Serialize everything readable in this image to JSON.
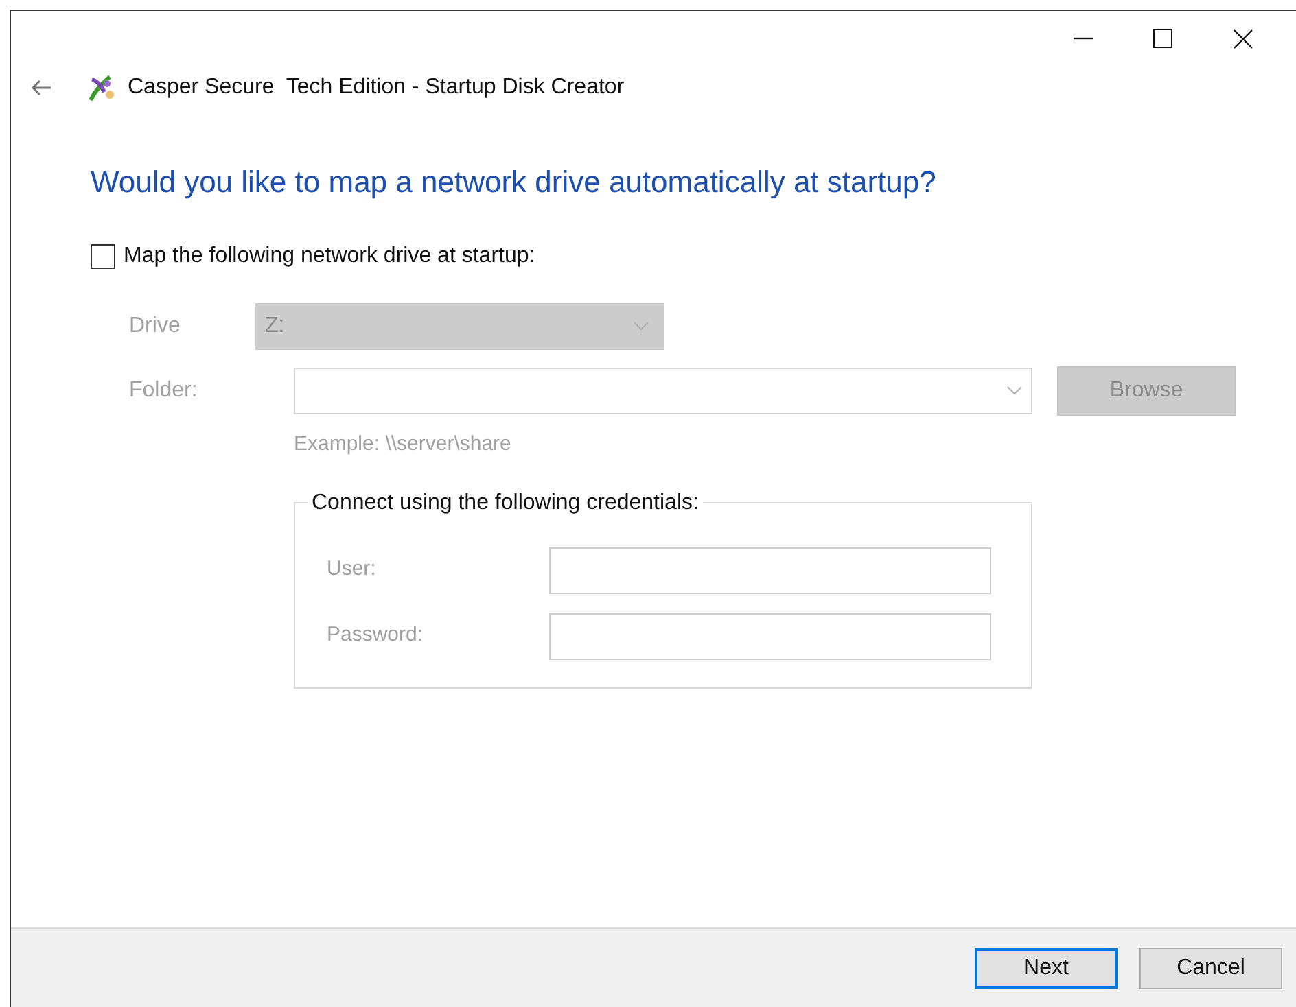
{
  "window": {
    "title": "Casper Secure  Tech Edition - Startup Disk Creator"
  },
  "heading": "Would you like to map a network drive automatically at startup?",
  "map_option": {
    "label": "Map the following network drive at startup:",
    "checked": false
  },
  "drive": {
    "label": "Drive",
    "value": "Z:",
    "disabled": true
  },
  "folder": {
    "label": "Folder:",
    "disabled": true,
    "browse": "Browse",
    "example": "Example: \\\\server\\share"
  },
  "credentials": {
    "title": "Connect using the following credentials:",
    "fields": [
      {
        "label": "User:",
        "disabled": true
      },
      {
        "label": "Password:",
        "disabled": true
      }
    ]
  },
  "buttons": [
    {
      "label": "Next",
      "default": true
    },
    {
      "label": "Cancel",
      "default": false
    }
  ]
}
